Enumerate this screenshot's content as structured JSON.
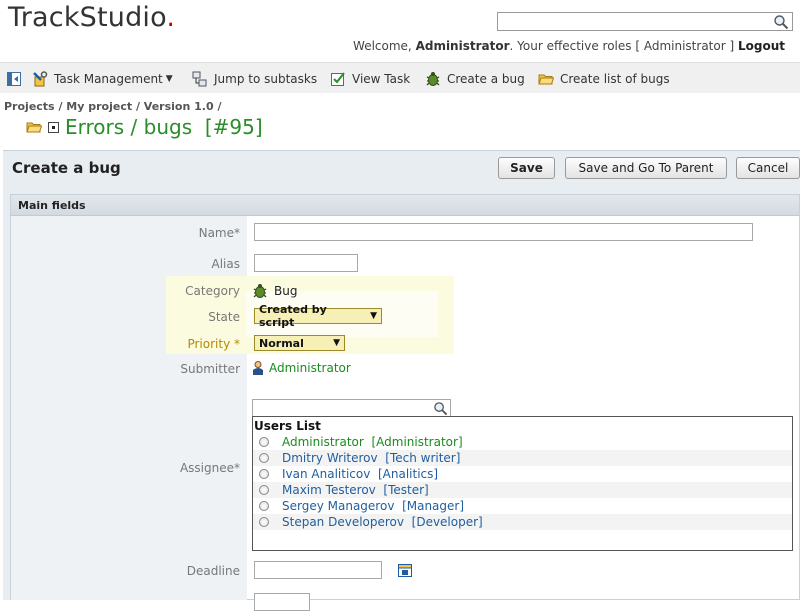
{
  "header": {
    "logo_main": "TrackStudio",
    "logo_dot": ".",
    "search_placeholder": "",
    "welcome_prefix": "Welcome, ",
    "user": "Administrator",
    "roles_text": ". Your effective roles",
    "roles_value": "[ Administrator ]",
    "logout": "Logout"
  },
  "toolbar": {
    "task_management": "Task Management",
    "jump_to_subtasks": "Jump to subtasks",
    "view_task": "View Task",
    "create_bug": "Create a bug",
    "create_list": "Create list of bugs"
  },
  "breadcrumb": {
    "items": [
      "Projects",
      "My project",
      "Version 1.0"
    ],
    "separator": " / "
  },
  "task": {
    "title": "Errors / bugs",
    "number": "[#95]"
  },
  "form": {
    "title": "Create a bug",
    "buttons": {
      "save": "Save",
      "save_parent": "Save and Go To Parent",
      "cancel": "Cancel"
    },
    "section_title": "Main fields",
    "labels": {
      "name": "Name*",
      "alias": "Alias",
      "category": "Category",
      "state": "State",
      "priority": "Priority *",
      "submitter": "Submitter",
      "assignee": "Assignee*",
      "deadline": "Deadline"
    },
    "values": {
      "name": "",
      "alias": "",
      "category": "Bug",
      "state": "Created by script",
      "priority": "Normal",
      "submitter": "Administrator",
      "deadline": ""
    },
    "users_list": {
      "title": "Users List",
      "users": [
        {
          "name": "Administrator",
          "role": "[Administrator]",
          "highlight": true
        },
        {
          "name": "Dmitry Writerov",
          "role": "[Tech writer]",
          "highlight": false
        },
        {
          "name": "Ivan Analiticov",
          "role": "[Analitics]",
          "highlight": false
        },
        {
          "name": "Maxim Testerov",
          "role": "[Tester]",
          "highlight": false
        },
        {
          "name": "Sergey Managerov",
          "role": "[Manager]",
          "highlight": false
        },
        {
          "name": "Stepan Developerov",
          "role": "[Developer]",
          "highlight": false
        }
      ]
    }
  },
  "colors": {
    "accent_green": "#2a8c2a",
    "link_blue": "#1f5e9e",
    "select_bg": "#f6f0b6",
    "logo_dot": "#cc0000"
  }
}
